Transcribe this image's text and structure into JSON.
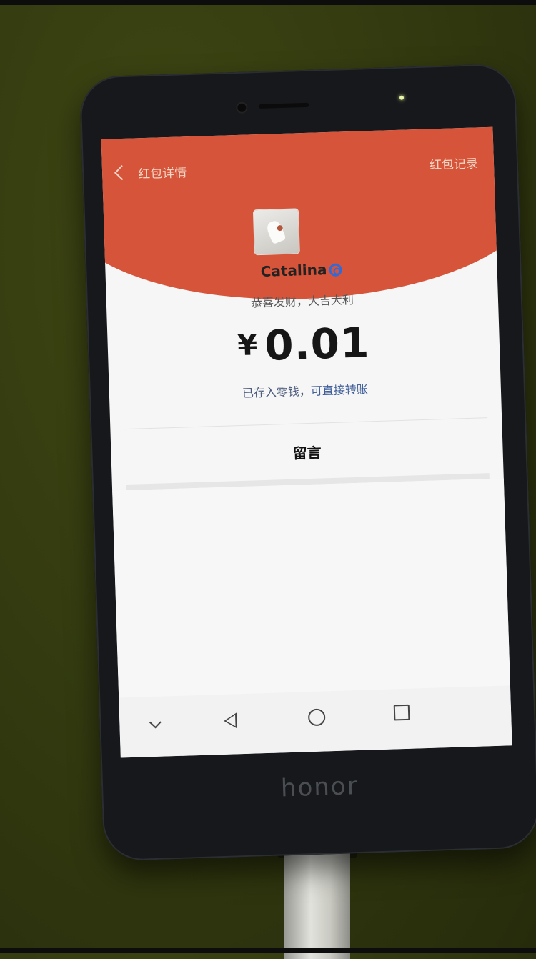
{
  "app_header": {
    "title": "红包详情",
    "record_link": "红包记录",
    "background_color": "#d65439"
  },
  "sender": {
    "name": "Catalina",
    "badge_icon": "swirl-icon",
    "greeting": "恭喜发财，大吉大利"
  },
  "amount": {
    "currency_symbol": "¥",
    "value": "0.01"
  },
  "status": {
    "text": "已存入零钱，",
    "link": "可直接转账"
  },
  "message_section": {
    "label": "留言"
  },
  "system_nav": {
    "icons": [
      "chevron-down-icon",
      "back-triangle-icon",
      "home-circle-icon",
      "recent-square-icon"
    ]
  },
  "device": {
    "brand": "honor"
  }
}
